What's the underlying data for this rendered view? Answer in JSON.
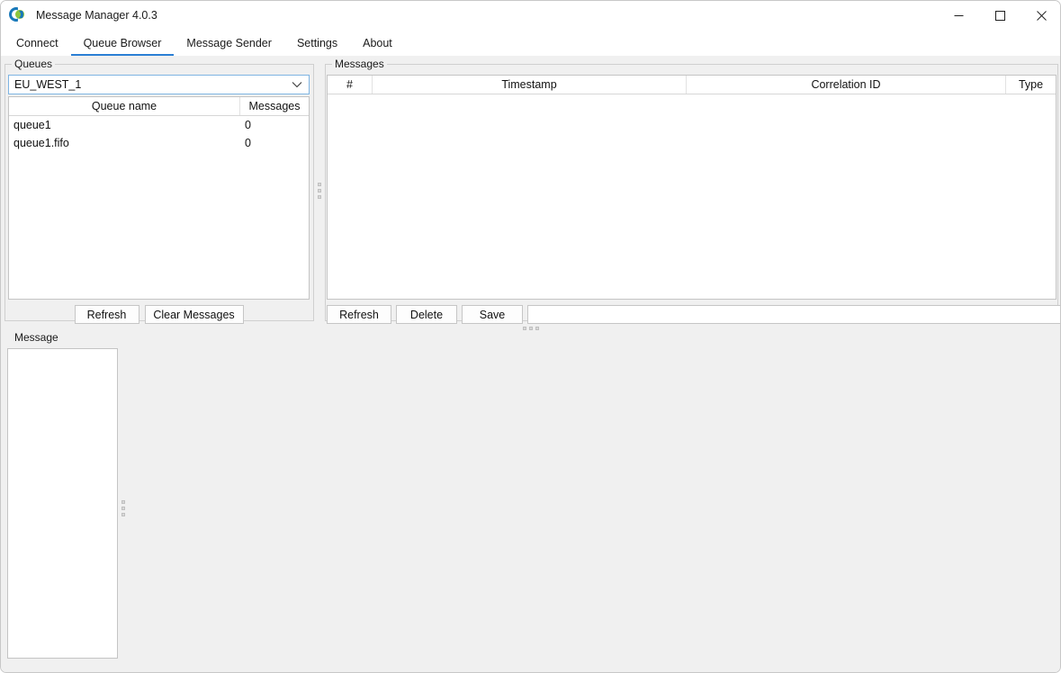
{
  "window": {
    "title": "Message Manager 4.0.3",
    "app_icon": "app-logo-icon",
    "controls": {
      "minimize": "minimize-icon",
      "maximize": "maximize-icon",
      "close": "close-icon"
    }
  },
  "tabs": [
    {
      "label": "Connect",
      "active": false
    },
    {
      "label": "Queue Browser",
      "active": true
    },
    {
      "label": "Message Sender",
      "active": false
    },
    {
      "label": "Settings",
      "active": false
    },
    {
      "label": "About",
      "active": false
    }
  ],
  "queues_panel": {
    "title": "Queues",
    "region_select": {
      "value": "EU_WEST_1",
      "chevron": "chevron-down-icon"
    },
    "table": {
      "columns": [
        "Queue name",
        "Messages"
      ],
      "rows": [
        {
          "name": "queue1",
          "messages": "0"
        },
        {
          "name": "queue1.fifo",
          "messages": "0"
        }
      ]
    },
    "buttons": {
      "refresh": "Refresh",
      "clear_messages": "Clear Messages"
    }
  },
  "messages_panel": {
    "title": "Messages",
    "table": {
      "columns": [
        "#",
        "Timestamp",
        "Correlation ID",
        "Type"
      ],
      "rows": []
    },
    "buttons": {
      "refresh": "Refresh",
      "delete": "Delete",
      "save": "Save"
    },
    "save_path": {
      "value": "",
      "placeholder": ""
    }
  },
  "message_panel": {
    "title": "Message",
    "list": {
      "items": []
    }
  },
  "colors": {
    "accent": "#2b7fd4",
    "window_bg": "#f0f0f0",
    "panel_bg": "#ffffff",
    "border": "#cfcfcf"
  }
}
